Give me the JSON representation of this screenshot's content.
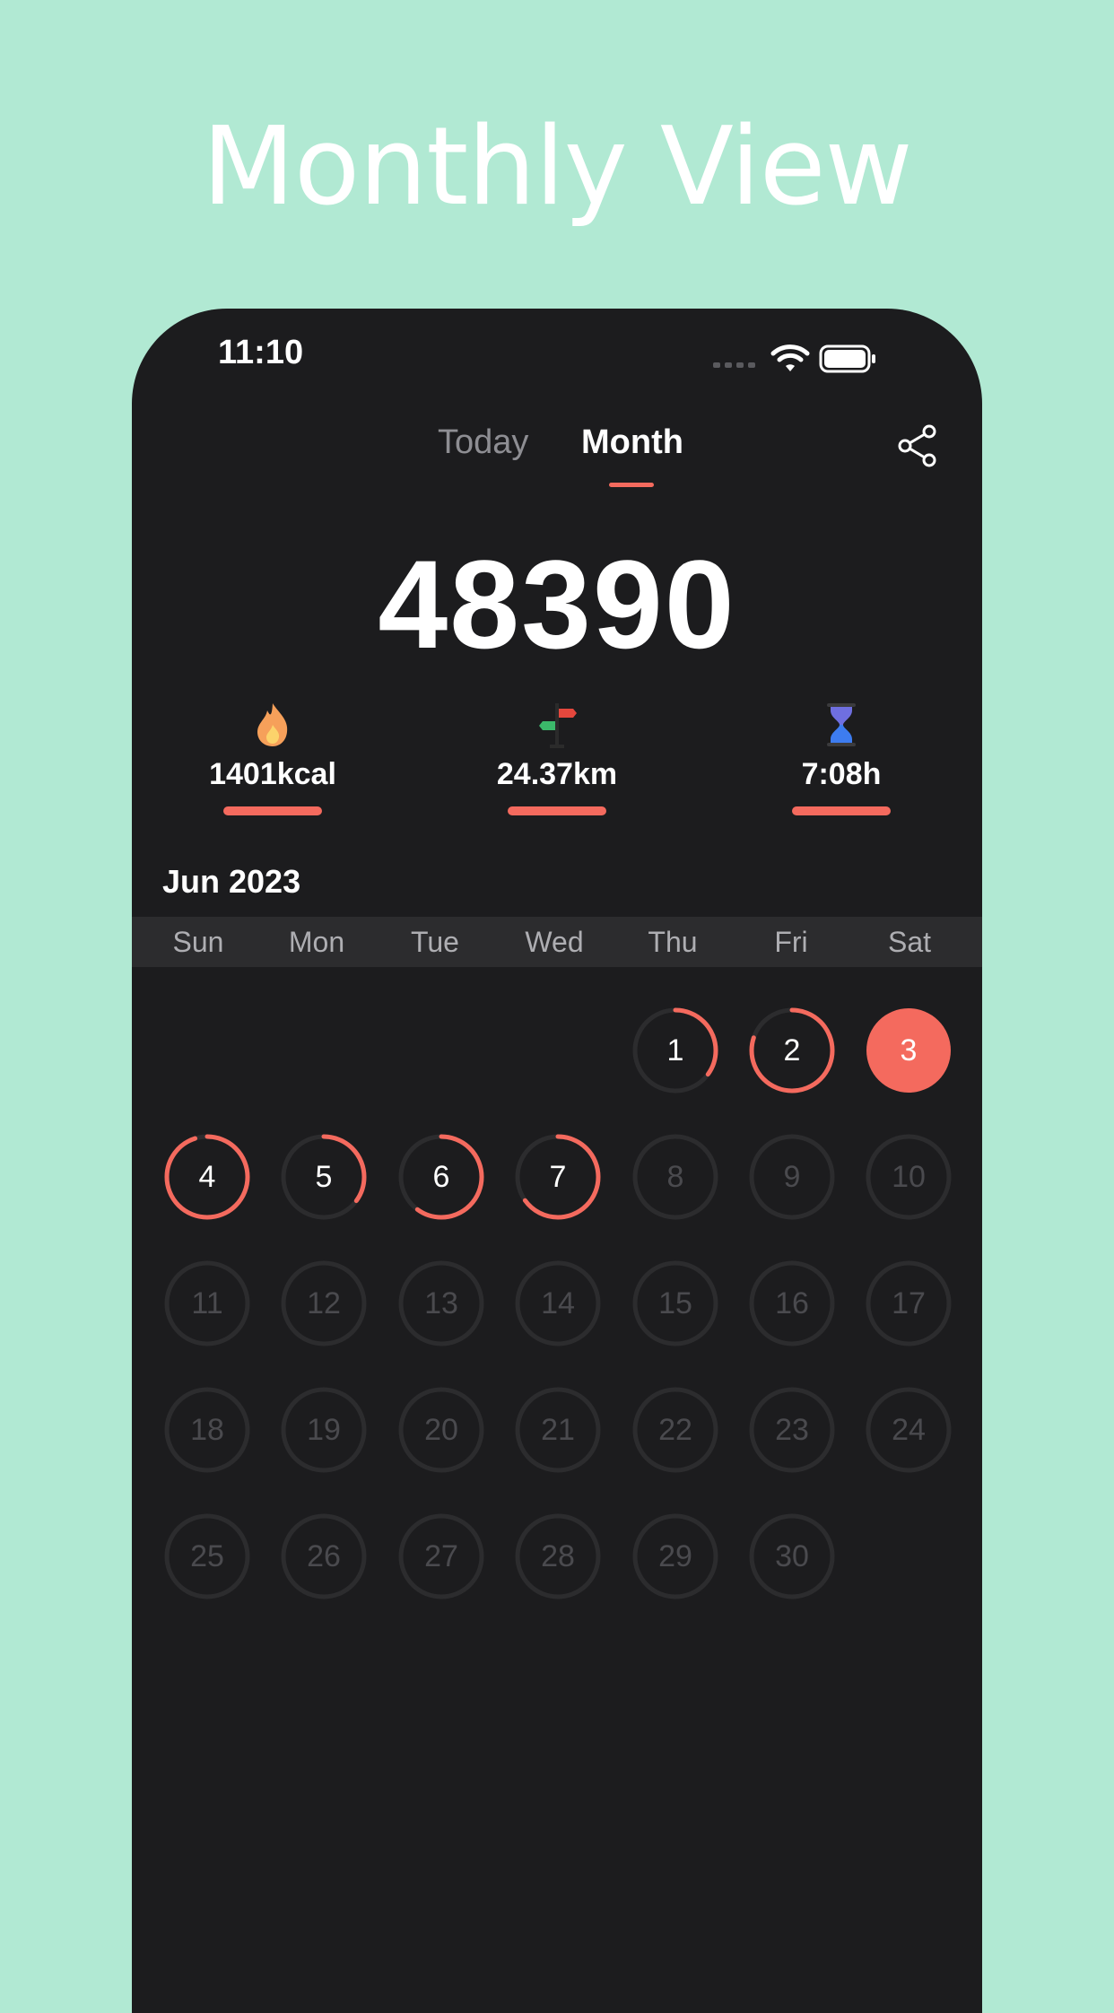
{
  "promo": {
    "title": "Monthly View"
  },
  "status_bar": {
    "time": "11:10"
  },
  "tabs": [
    {
      "label": "Today",
      "selected": false
    },
    {
      "label": "Month",
      "selected": true
    }
  ],
  "total_steps": "48390",
  "stats": [
    {
      "icon": "flame-icon",
      "value": "1401kcal"
    },
    {
      "icon": "signpost-icon",
      "value": "24.37km"
    },
    {
      "icon": "hourglass-icon",
      "value": "7:08h"
    }
  ],
  "calendar": {
    "month": "Jun 2023",
    "weekdays": [
      "Sun",
      "Mon",
      "Tue",
      "Wed",
      "Thu",
      "Fri",
      "Sat"
    ],
    "first_weekday_index": 4,
    "days": [
      {
        "label": "1",
        "progress": 0.35
      },
      {
        "label": "2",
        "progress": 0.8
      },
      {
        "label": "3",
        "progress": 1.0
      },
      {
        "label": "4",
        "progress": 0.95
      },
      {
        "label": "5",
        "progress": 0.35
      },
      {
        "label": "6",
        "progress": 0.6
      },
      {
        "label": "7",
        "progress": 0.65
      },
      {
        "label": "8",
        "progress": 0
      },
      {
        "label": "9",
        "progress": 0
      },
      {
        "label": "10",
        "progress": 0
      },
      {
        "label": "11",
        "progress": 0
      },
      {
        "label": "12",
        "progress": 0
      },
      {
        "label": "13",
        "progress": 0
      },
      {
        "label": "14",
        "progress": 0
      },
      {
        "label": "15",
        "progress": 0
      },
      {
        "label": "16",
        "progress": 0
      },
      {
        "label": "17",
        "progress": 0
      },
      {
        "label": "18",
        "progress": 0
      },
      {
        "label": "19",
        "progress": 0
      },
      {
        "label": "20",
        "progress": 0
      },
      {
        "label": "21",
        "progress": 0
      },
      {
        "label": "22",
        "progress": 0
      },
      {
        "label": "23",
        "progress": 0
      },
      {
        "label": "24",
        "progress": 0
      },
      {
        "label": "25",
        "progress": 0
      },
      {
        "label": "26",
        "progress": 0
      },
      {
        "label": "27",
        "progress": 0
      },
      {
        "label": "28",
        "progress": 0
      },
      {
        "label": "29",
        "progress": 0
      },
      {
        "label": "30",
        "progress": 0
      }
    ]
  },
  "colors": {
    "accent": "#f46a5e",
    "background": "#b1e9d3",
    "phone_bg": "#1c1c1e",
    "ring_track": "#2c2c2e",
    "active_text": "#ffffff",
    "inactive_text": "#4a4a4e"
  }
}
